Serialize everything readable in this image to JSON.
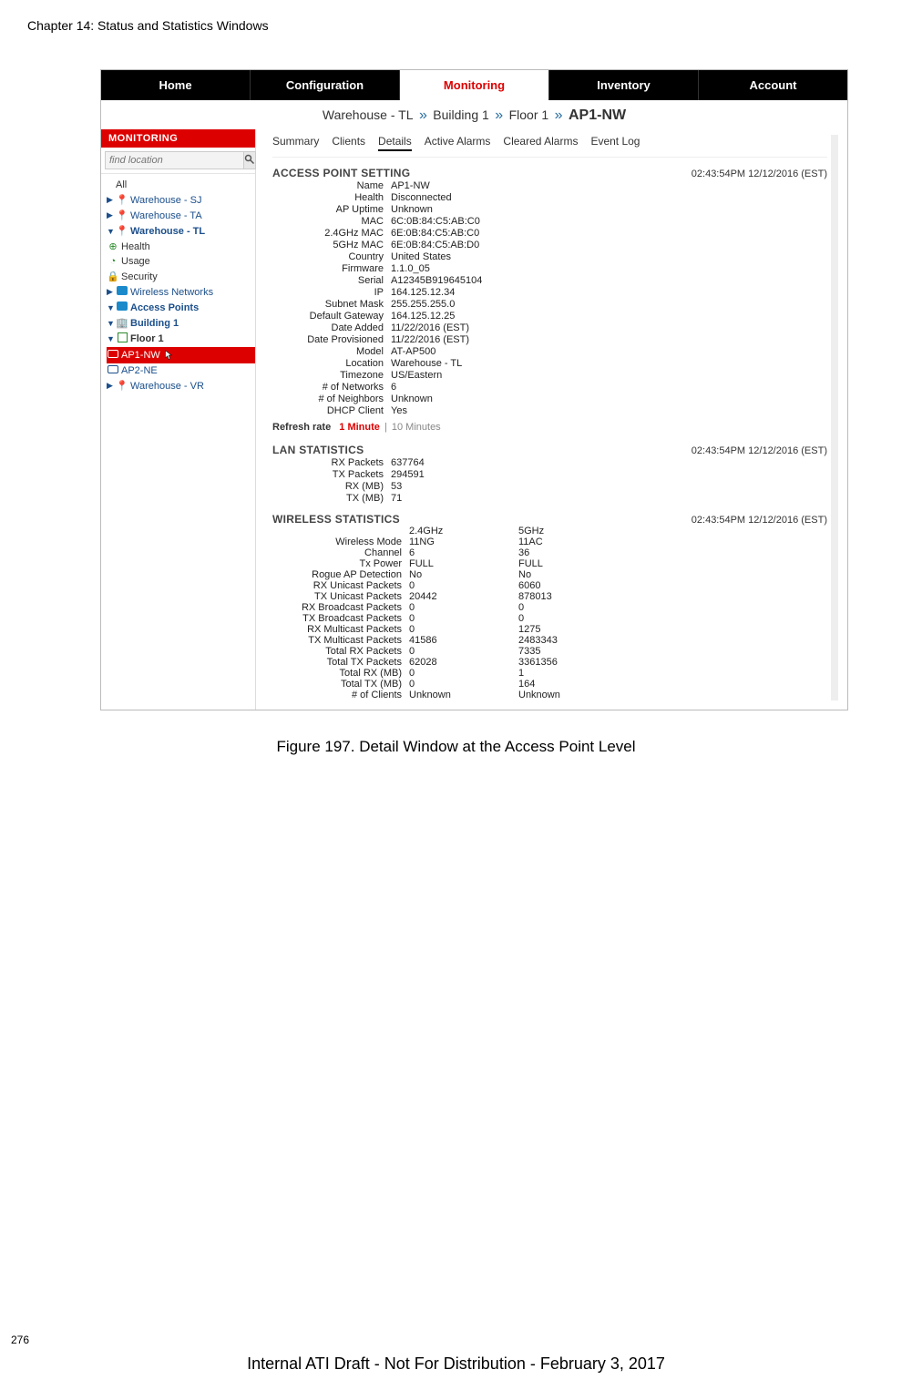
{
  "page": {
    "chapter_header": "Chapter 14: Status and Statistics Windows",
    "page_number": "276",
    "footer": "Internal ATI Draft - Not For Distribution - February 3, 2017",
    "figure_caption": "Figure 197. Detail Window at the Access Point Level"
  },
  "main_nav": {
    "home": "Home",
    "configuration": "Configuration",
    "monitoring": "Monitoring",
    "inventory": "Inventory",
    "account": "Account"
  },
  "breadcrumb": {
    "l1": "Warehouse - TL",
    "l2": "Building 1",
    "l3": "Floor 1",
    "l4": "AP1-NW",
    "sep": "»"
  },
  "sidebar": {
    "title": "MONITORING",
    "search_placeholder": "find location",
    "all": "All",
    "wh_sj": "Warehouse - SJ",
    "wh_ta": "Warehouse - TA",
    "wh_tl": "Warehouse - TL",
    "health": "Health",
    "usage": "Usage",
    "security": "Security",
    "wireless": "Wireless Networks",
    "aps": "Access Points",
    "bldg1": "Building 1",
    "floor1": "Floor 1",
    "ap1": "AP1-NW",
    "ap2": "AP2-NE",
    "wh_vr": "Warehouse - VR"
  },
  "tabs": {
    "summary": "Summary",
    "clients": "Clients",
    "details": "Details",
    "active": "Active Alarms",
    "cleared": "Cleared Alarms",
    "log": "Event Log"
  },
  "timestamp": "02:43:54PM 12/12/2016 (EST)",
  "sections": {
    "ap_setting": "ACCESS POINT SETTING",
    "lan_stats": "LAN STATISTICS",
    "wireless_stats": "WIRELESS STATISTICS"
  },
  "ap": {
    "k": {
      "Name": "Name",
      "Health": "Health",
      "AP_Uptime": "AP Uptime",
      "MAC": "MAC",
      "MAC24": "2.4GHz MAC",
      "MAC5": "5GHz MAC",
      "Country": "Country",
      "Firmware": "Firmware",
      "Serial": "Serial",
      "IP": "IP",
      "Subnet": "Subnet Mask",
      "Gateway": "Default Gateway",
      "DateAdded": "Date Added",
      "DateProv": "Date Provisioned",
      "Model": "Model",
      "Location": "Location",
      "Timezone": "Timezone",
      "NetCount": "# of Networks",
      "Neighbors": "# of Neighbors",
      "DHCP": "DHCP Client"
    },
    "v": {
      "Name": "AP1-NW",
      "Health": "Disconnected",
      "AP_Uptime": "Unknown",
      "MAC": "6C:0B:84:C5:AB:C0",
      "MAC24": "6E:0B:84:C5:AB:C0",
      "MAC5": "6E:0B:84:C5:AB:D0",
      "Country": "United States",
      "Firmware": "1.1.0_05",
      "Serial": "A12345B919645104",
      "IP": "164.125.12.34",
      "Subnet": "255.255.255.0",
      "Gateway": "164.125.12.25",
      "DateAdded": "11/22/2016 (EST)",
      "DateProv": "11/22/2016 (EST)",
      "Model": "AT-AP500",
      "Location": "Warehouse - TL",
      "Timezone": "US/Eastern",
      "NetCount": "6",
      "Neighbors": "Unknown",
      "DHCP": "Yes"
    }
  },
  "refresh": {
    "label": "Refresh rate",
    "opt1": "1 Minute",
    "sep": "|",
    "opt2": "10 Minutes"
  },
  "lan": {
    "k": {
      "rxp": "RX Packets",
      "txp": "TX Packets",
      "rxm": "RX (MB)",
      "txm": "TX (MB)"
    },
    "v": {
      "rxp": "637764",
      "txp": "294591",
      "rxm": "53",
      "txm": "71"
    }
  },
  "wireless": {
    "head": {
      "blank": "",
      "c24": "2.4GHz",
      "c5": "5GHz"
    },
    "rows": [
      {
        "label": "Wireless Mode",
        "c24": "11NG",
        "c5": "11AC"
      },
      {
        "label": "Channel",
        "c24": "6",
        "c5": "36"
      },
      {
        "label": "Tx Power",
        "c24": "FULL",
        "c5": "FULL"
      },
      {
        "label": "Rogue AP Detection",
        "c24": "No",
        "c5": "No"
      },
      {
        "label": "RX Unicast Packets",
        "c24": "0",
        "c5": "6060"
      },
      {
        "label": "TX Unicast Packets",
        "c24": "20442",
        "c5": "878013"
      },
      {
        "label": "RX Broadcast Packets",
        "c24": "0",
        "c5": "0"
      },
      {
        "label": "TX Broadcast Packets",
        "c24": "0",
        "c5": "0"
      },
      {
        "label": "RX Multicast Packets",
        "c24": "0",
        "c5": "1275"
      },
      {
        "label": "TX Multicast Packets",
        "c24": "41586",
        "c5": "2483343"
      },
      {
        "label": "Total RX Packets",
        "c24": "0",
        "c5": "7335"
      },
      {
        "label": "Total TX Packets",
        "c24": "62028",
        "c5": "3361356"
      },
      {
        "label": "Total RX (MB)",
        "c24": "0",
        "c5": "1"
      },
      {
        "label": "Total TX (MB)",
        "c24": "0",
        "c5": "164"
      },
      {
        "label": "# of Clients",
        "c24": "Unknown",
        "c5": "Unknown"
      }
    ]
  }
}
